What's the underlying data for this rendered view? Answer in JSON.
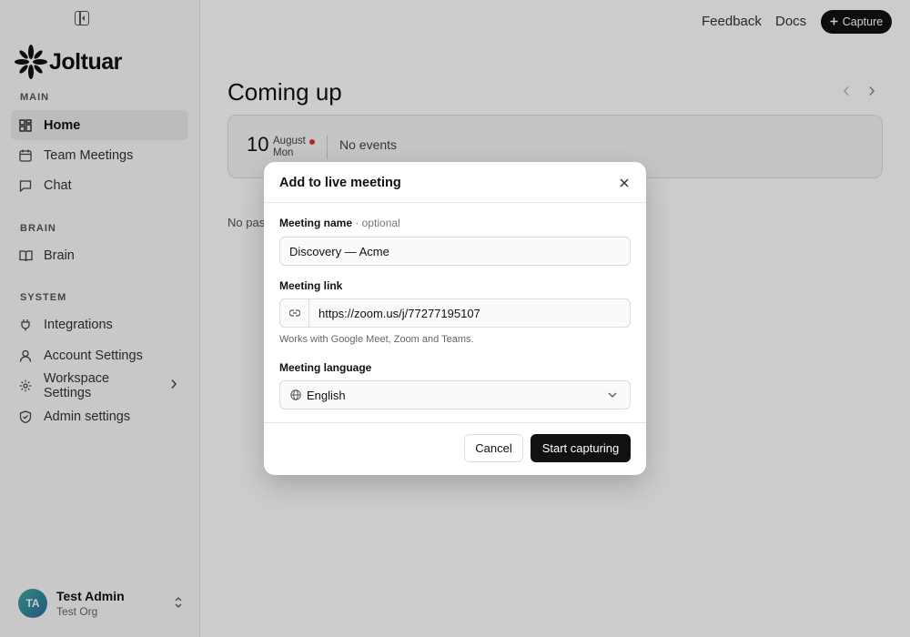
{
  "app": {
    "brand": "Joltuar"
  },
  "topbar": {
    "feedback": "Feedback",
    "docs": "Docs",
    "capture_label": "Capture"
  },
  "sidebar": {
    "sections": [
      {
        "label": "MAIN",
        "items": [
          {
            "label": "Home",
            "icon": "dashboard-icon",
            "active": true
          },
          {
            "label": "Team Meetings",
            "icon": "calendar-icon"
          },
          {
            "label": "Chat",
            "icon": "chat-icon"
          }
        ]
      },
      {
        "label": "BRAIN",
        "items": [
          {
            "label": "Brain",
            "icon": "book-icon"
          }
        ]
      },
      {
        "label": "SYSTEM",
        "items": [
          {
            "label": "Integrations",
            "icon": "plug-icon"
          },
          {
            "label": "Account Settings",
            "icon": "user-icon"
          },
          {
            "label": "Workspace Settings",
            "icon": "gear-icon"
          },
          {
            "label": "Admin settings",
            "icon": "shield-icon"
          }
        ]
      }
    ],
    "user": {
      "initials": "TA",
      "name": "Test Admin",
      "org": "Test Org"
    }
  },
  "main": {
    "title": "Coming up",
    "event_day": {
      "day": "10",
      "month": "August",
      "weekday": "Mon",
      "status": "No events"
    },
    "past_text": "No pas"
  },
  "modal": {
    "title": "Add to live meeting",
    "name_label": "Meeting name",
    "name_optional": " · optional",
    "name_value": "Discovery — Acme",
    "link_label": "Meeting link",
    "link_value": "https://zoom.us/j/77277195107",
    "link_helper": "Works with Google Meet, Zoom and Teams.",
    "language_label": "Meeting language",
    "language_value": "English",
    "cancel_label": "Cancel",
    "start_label": "Start capturing"
  },
  "colors": {
    "primary": "#111111",
    "overlay": "rgba(0,0,0,0.2)",
    "status_dot": "#dd3333"
  }
}
